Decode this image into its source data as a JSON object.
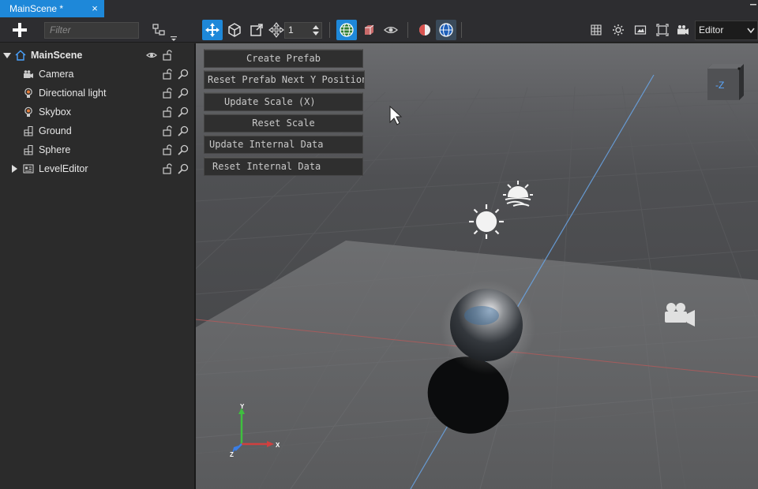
{
  "tab": {
    "title": "MainScene *",
    "close_glyph": "×"
  },
  "toolbar": {
    "filter_placeholder": "Filter",
    "snap_value": "1",
    "view_mode": "Editor",
    "accent": "#1e88d9"
  },
  "hierarchy": {
    "root": {
      "label": "MainScene",
      "icon": "home-icon"
    },
    "items": [
      {
        "label": "Camera",
        "icon": "camera-icon"
      },
      {
        "label": "Directional light",
        "icon": "light-bulb-icon"
      },
      {
        "label": "Skybox",
        "icon": "light-bulb-icon"
      },
      {
        "label": "Ground",
        "icon": "mesh-icon"
      },
      {
        "label": "Sphere",
        "icon": "mesh-icon"
      },
      {
        "label": "LevelEditor",
        "icon": "script-icon",
        "expandable": true
      }
    ]
  },
  "viewport": {
    "buttons": [
      "Create Prefab",
      "Reset Prefab Next Y Position",
      "Update Scale (X)",
      "Reset Scale",
      "Update Internal Data",
      "Reset Internal Data"
    ],
    "view_cube_label": "-Z",
    "axis_labels": {
      "x": "X",
      "y": "Y",
      "z": "Z"
    }
  }
}
